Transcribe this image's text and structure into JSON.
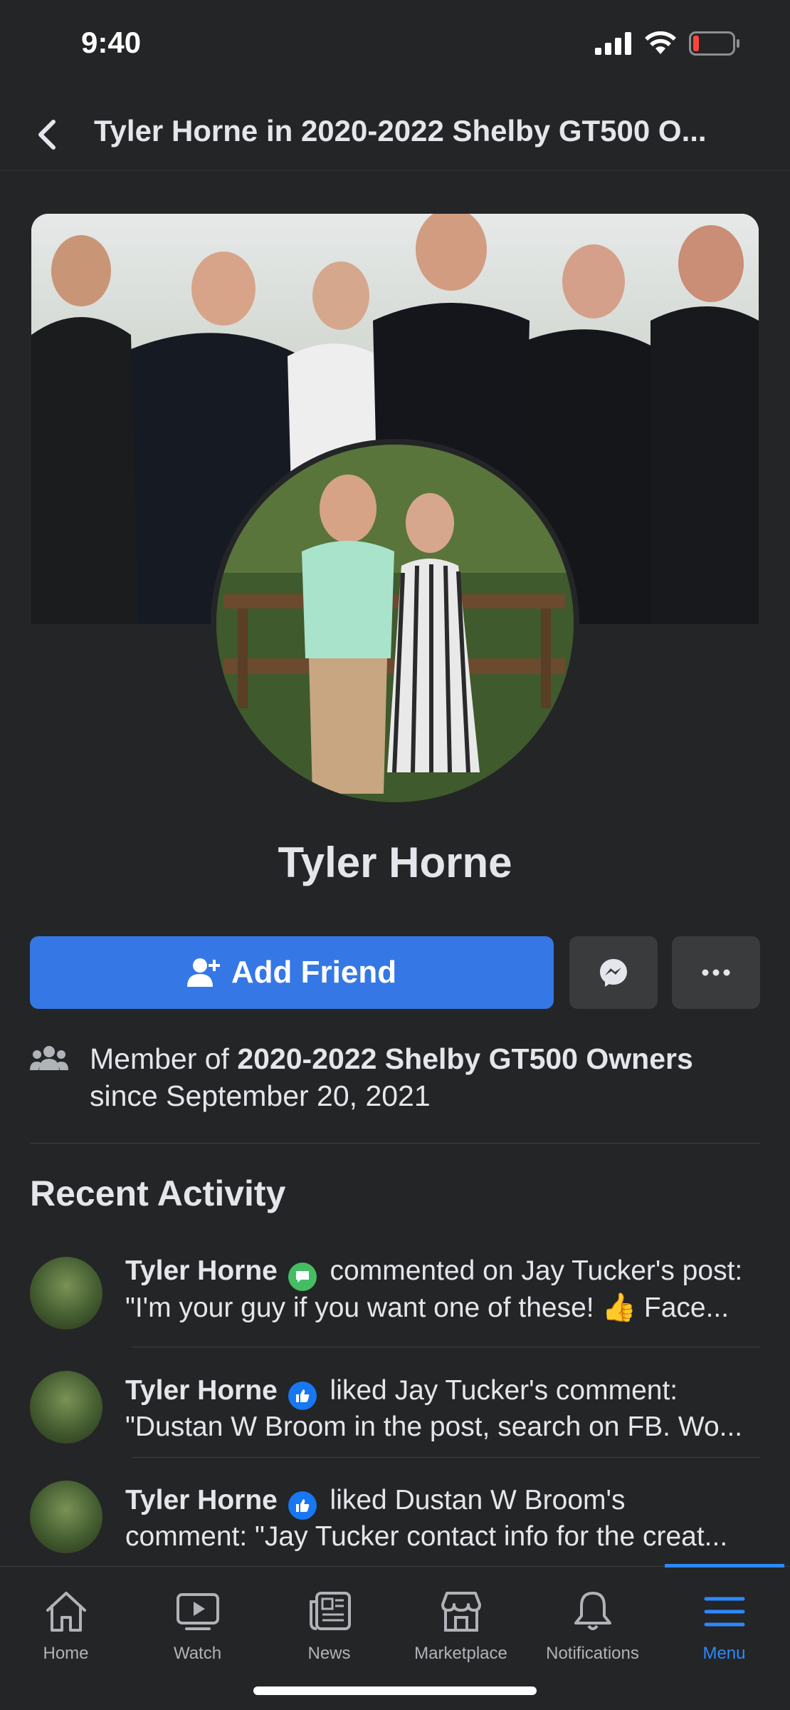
{
  "status_bar": {
    "time": "9:40"
  },
  "header": {
    "title": "Tyler Horne in 2020-2022 Shelby GT500 O..."
  },
  "profile": {
    "name": "Tyler Horne"
  },
  "actions": {
    "add_friend_label": "Add Friend"
  },
  "membership": {
    "prefix": "Member of ",
    "group_name": "2020-2022 Shelby GT500 Owners",
    "since": "since September 20, 2021"
  },
  "recent_activity": {
    "title": "Recent Activity",
    "items": [
      {
        "name": "Tyler Horne",
        "badge": "comment-icon",
        "action": "commented on Jay Tucker's post:",
        "preview": "\"I'm your guy if you want one of these! 👍 Face..."
      },
      {
        "name": "Tyler Horne",
        "badge": "like-icon",
        "action": "liked Jay Tucker's comment:",
        "preview": "\"Dustan W Broom in the post, search on FB. Wo..."
      },
      {
        "name": "Tyler Horne",
        "badge": "like-icon",
        "action": "liked Dustan W Broom's",
        "preview": "comment: \"Jay Tucker contact info for the creat..."
      }
    ]
  },
  "tab_bar": {
    "tabs": [
      {
        "label": "Home",
        "icon": "home-icon"
      },
      {
        "label": "Watch",
        "icon": "watch-icon"
      },
      {
        "label": "News",
        "icon": "news-icon"
      },
      {
        "label": "Marketplace",
        "icon": "marketplace-icon"
      },
      {
        "label": "Notifications",
        "icon": "bell-icon"
      },
      {
        "label": "Menu",
        "icon": "menu-icon",
        "active": true
      }
    ]
  },
  "colors": {
    "background": "#242526",
    "primary_button": "#3578e5",
    "secondary_button": "#3a3b3c",
    "active_tab": "#2d88ff"
  }
}
